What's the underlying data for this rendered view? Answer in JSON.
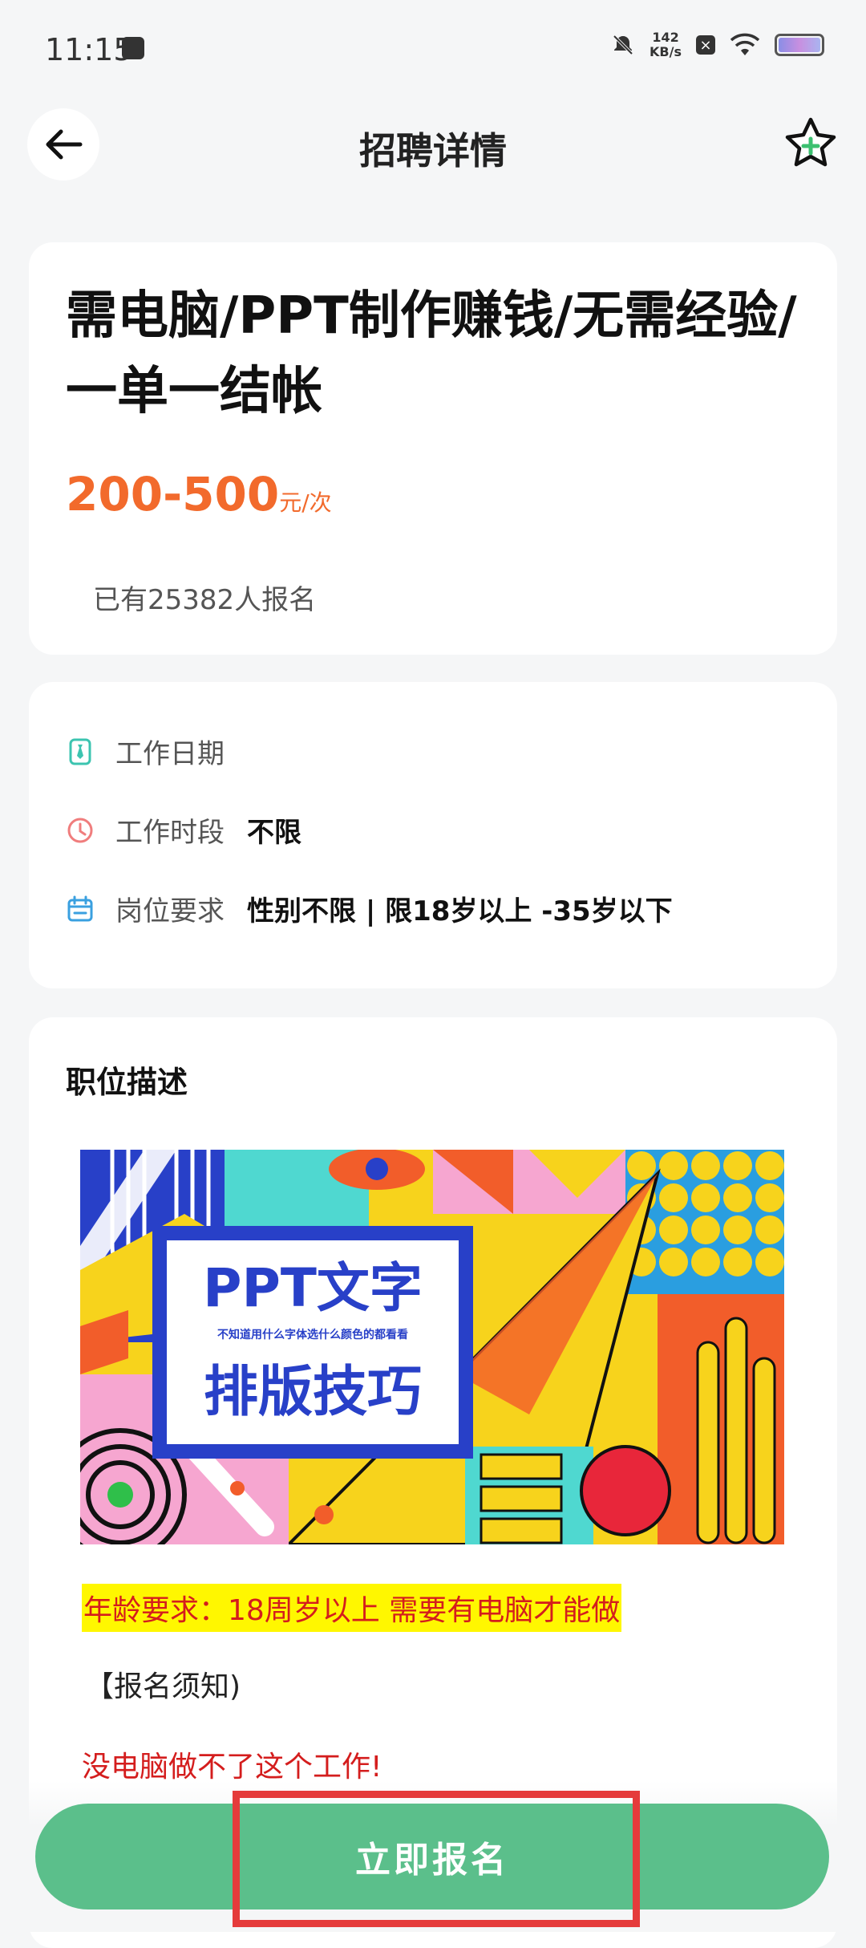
{
  "status": {
    "time": "11:15",
    "speed_value": "142",
    "speed_unit": "KB/s",
    "icons": [
      "message-icon",
      "mute-bell-icon",
      "close-box-icon",
      "wifi-icon",
      "battery-icon"
    ]
  },
  "header": {
    "title": "招聘详情",
    "back_icon": "arrow-left-icon",
    "fav_icon": "star-plus-icon"
  },
  "job": {
    "title": "需电脑/PPT制作赚钱/无需经验/一单一结帐",
    "salary_range": "200-500",
    "salary_unit": "元/次",
    "applied_text": "已有25382人报名"
  },
  "info": {
    "rows": [
      {
        "icon": "tie-icon",
        "label": "工作日期",
        "value": ""
      },
      {
        "icon": "clock-icon",
        "label": "工作时段",
        "value": "不限"
      },
      {
        "icon": "calendar-icon",
        "label": "岗位要求",
        "value": "性别不限 | 限18岁以上 -35岁以下"
      }
    ]
  },
  "description": {
    "section_title": "职位描述",
    "banner": {
      "line1": "PPT文字",
      "line2": "不知道用什么字体选什么颜色的都看看",
      "line3": "排版技巧"
    },
    "age_requirement": "年龄要求：18周岁以上 需要有电脑才能做",
    "notice": "【报名须知)",
    "need_computer": "没电脑做不了这个工作!"
  },
  "footer": {
    "apply_label": "立即报名"
  },
  "colors": {
    "accent_green": "#5bbf8b",
    "salary_orange": "#f26a2c",
    "warning_red": "#d41d1d",
    "highlight_yellow": "#fff700"
  }
}
